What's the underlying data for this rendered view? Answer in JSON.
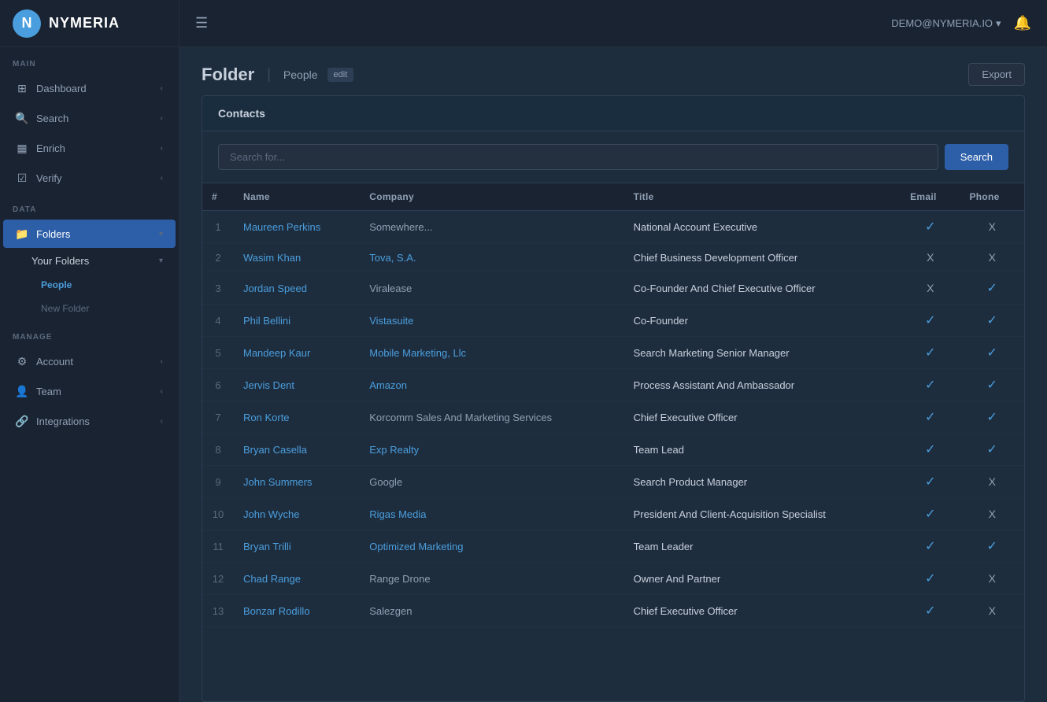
{
  "app": {
    "name": "NYMERIA",
    "logo_symbol": "N"
  },
  "topbar": {
    "user_email": "DEMO@NYMERIA.IO",
    "dropdown_arrow": "▾"
  },
  "sidebar": {
    "main_label": "MAIN",
    "data_label": "DATA",
    "manage_label": "MANAGE",
    "items": {
      "dashboard": "Dashboard",
      "search": "Search",
      "enrich": "Enrich",
      "verify": "Verify",
      "folders": "Folders",
      "your_folders": "Your Folders",
      "people": "People",
      "new_folder": "New Folder",
      "account": "Account",
      "team": "Team",
      "integrations": "Integrations"
    }
  },
  "page": {
    "title": "Folder",
    "subtitle": "People",
    "edit_label": "edit",
    "export_label": "Export"
  },
  "contacts": {
    "section_title": "Contacts",
    "search_placeholder": "Search for...",
    "search_button": "Search",
    "columns": {
      "num": "#",
      "name": "Name",
      "company": "Company",
      "title": "Title",
      "email": "Email",
      "phone": "Phone"
    },
    "rows": [
      {
        "num": 1,
        "name": "Maureen Perkins",
        "company": "Somewhere...",
        "company_link": false,
        "title": "National Account Executive",
        "email": "check",
        "phone": "x"
      },
      {
        "num": 2,
        "name": "Wasim Khan",
        "company": "Tova, S.A.",
        "company_link": true,
        "title": "Chief Business Development Officer",
        "email": "x",
        "phone": "x"
      },
      {
        "num": 3,
        "name": "Jordan Speed",
        "company": "Viralease",
        "company_link": false,
        "title": "Co-Founder And Chief Executive Officer",
        "email": "x",
        "phone": "check"
      },
      {
        "num": 4,
        "name": "Phil Bellini",
        "company": "Vistasuite",
        "company_link": true,
        "title": "Co-Founder",
        "email": "check",
        "phone": "check"
      },
      {
        "num": 5,
        "name": "Mandeep Kaur",
        "company": "Mobile Marketing, Llc",
        "company_link": true,
        "title": "Search Marketing Senior Manager",
        "email": "check",
        "phone": "check"
      },
      {
        "num": 6,
        "name": "Jervis Dent",
        "company": "Amazon",
        "company_link": true,
        "title": "Process Assistant And Ambassador",
        "email": "check",
        "phone": "check"
      },
      {
        "num": 7,
        "name": "Ron Korte",
        "company": "Korcomm Sales And Marketing Services",
        "company_link": false,
        "title": "Chief Executive Officer",
        "email": "check",
        "phone": "check"
      },
      {
        "num": 8,
        "name": "Bryan Casella",
        "company": "Exp Realty",
        "company_link": true,
        "title": "Team Lead",
        "email": "check",
        "phone": "check"
      },
      {
        "num": 9,
        "name": "John Summers",
        "company": "Google",
        "company_link": false,
        "title": "Search Product Manager",
        "email": "check",
        "phone": "x"
      },
      {
        "num": 10,
        "name": "John Wyche",
        "company": "Rigas Media",
        "company_link": true,
        "title": "President And Client-Acquisition Specialist",
        "email": "check",
        "phone": "x"
      },
      {
        "num": 11,
        "name": "Bryan Trilli",
        "company": "Optimized Marketing",
        "company_link": true,
        "title": "Team Leader",
        "email": "check",
        "phone": "check"
      },
      {
        "num": 12,
        "name": "Chad Range",
        "company": "Range Drone",
        "company_link": false,
        "title": "Owner And Partner",
        "email": "check",
        "phone": "x"
      },
      {
        "num": 13,
        "name": "Bonzar Rodillo",
        "company": "Salezgen",
        "company_link": false,
        "title": "Chief Executive Officer",
        "email": "check",
        "phone": "x"
      }
    ]
  }
}
